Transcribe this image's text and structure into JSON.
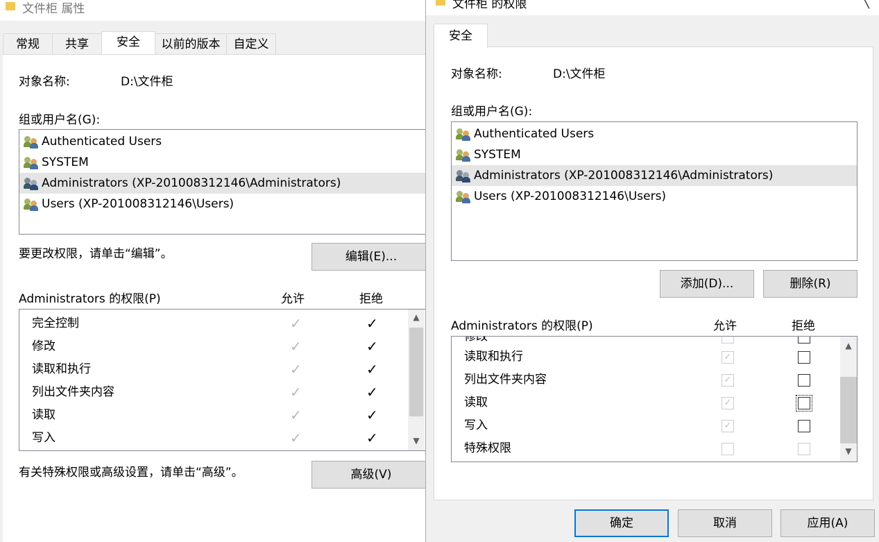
{
  "left": {
    "title": "文件柜 属性",
    "tabs": [
      "常规",
      "共享",
      "安全",
      "以前的版本",
      "自定义"
    ],
    "active_tab": "安全",
    "object_label": "对象名称:",
    "object_value": "D:\\文件柜",
    "group_label": "组或用户名(G):",
    "users": [
      "Authenticated Users",
      "SYSTEM",
      "Administrators (XP-201008312146\\Administrators)",
      "Users (XP-201008312146\\Users)"
    ],
    "selected_user_index": 2,
    "edit_hint": "要更改权限，请单击“编辑”。",
    "edit_button": "编辑(E)...",
    "perm_header": "Administrators 的权限(P)",
    "allow_header": "允许",
    "deny_header": "拒绝",
    "permissions": [
      {
        "name": "完全控制",
        "allow": "✓",
        "deny": "✓"
      },
      {
        "name": "修改",
        "allow": "✓",
        "deny": "✓"
      },
      {
        "name": "读取和执行",
        "allow": "✓",
        "deny": "✓"
      },
      {
        "name": "列出文件夹内容",
        "allow": "✓",
        "deny": "✓"
      },
      {
        "name": "读取",
        "allow": "✓",
        "deny": "✓"
      },
      {
        "name": "写入",
        "allow": "✓",
        "deny": "✓"
      }
    ],
    "advanced_hint": "有关特殊权限或高级设置，请单击“高级”。",
    "advanced_button": "高级(V)"
  },
  "right": {
    "title": "文件柜 的权限",
    "close_glyph": "╲",
    "tab": "安全",
    "object_label": "对象名称:",
    "object_value": "D:\\文件柜",
    "group_label": "组或用户名(G):",
    "users": [
      "Authenticated Users",
      "SYSTEM",
      "Administrators (XP-201008312146\\Administrators)",
      "Users (XP-201008312146\\Users)"
    ],
    "selected_user_index": 2,
    "add_button": "添加(D)...",
    "remove_button": "删除(R)",
    "perm_header": "Administrators 的权限(P)",
    "allow_header": "允许",
    "deny_header": "拒绝",
    "partial_row": "修改",
    "permissions": [
      {
        "name": "读取和执行",
        "allow": true,
        "deny": false
      },
      {
        "name": "列出文件夹内容",
        "allow": true,
        "deny": false
      },
      {
        "name": "读取",
        "allow": true,
        "deny": false
      },
      {
        "name": "写入",
        "allow": true,
        "deny": false
      },
      {
        "name": "特殊权限",
        "allow": false,
        "deny": false
      }
    ],
    "ok_button": "确定",
    "cancel_button": "取消",
    "apply_button": "应用(A)"
  },
  "colors": {
    "selection": "#e5e5e5",
    "accent_border": "#0078d7",
    "disabled_check": "#b8b8b8"
  }
}
